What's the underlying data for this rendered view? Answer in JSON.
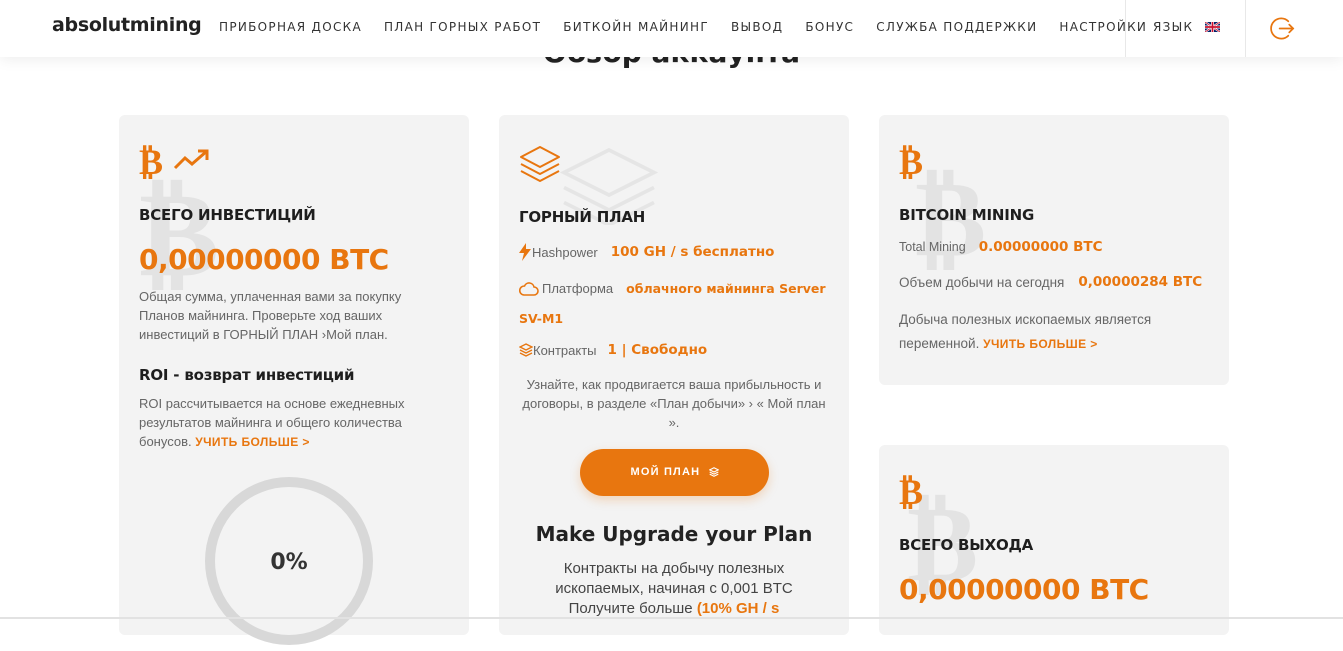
{
  "header": {
    "logo": "absolutmining",
    "nav": [
      "ПРИБОРНАЯ ДОСКА",
      "ПЛАН ГОРНЫХ РАБОТ",
      "БИТКОЙН МАЙНИНГ",
      "ВЫВОД",
      "БОНУС",
      "СЛУЖБА ПОДДЕРЖКИ",
      "НАСТРОЙКИ"
    ],
    "language_label": "ЯЗЫК"
  },
  "page_title": "Обзор аккаунта",
  "investments_card": {
    "title": "ВСЕГО ИНВЕСТИЦИЙ",
    "value": "0,00000000 BTC",
    "description": "Общая сумма, уплаченная вами за покупку Планов майнинга. Проверьте ход ваших инвестиций в ГОРНЫЙ ПЛАН ›Мой план.",
    "roi_title": "ROI - возврат инвестиций",
    "roi_description": "ROI рассчитывается на основе ежедневных результатов майнинга и общего количества бонусов.",
    "roi_link": "УЧИТЬ БОЛЬШЕ >",
    "roi_percent": "0%",
    "roi_progress": 0
  },
  "plan_card": {
    "title": "ГОРНЫЙ ПЛАН",
    "hashpower_label": "Hashpower",
    "hashpower_value": "100 GH / s бесплатно",
    "platform_label": "Платформа",
    "platform_value_1": "облачного майнинга Server",
    "platform_value_2": "SV-M1",
    "contracts_label": "Контракты",
    "contracts_value": "1 | Свободно",
    "info": "Узнайте, как продвигается ваша прибыльность и договоры, в разделе «План добычи» › « Мой план ».",
    "button_label": "МОЙ ПЛАН",
    "upgrade_title": "Make Upgrade your Plan",
    "upgrade_line1": "Контракты на добычу полезных",
    "upgrade_line2": "ископаемых, начиная с 0,001 BTC",
    "upgrade_line3": "Получите больше",
    "upgrade_highlight": "(10% GH / s"
  },
  "mining_card": {
    "title": "BITCOIN MINING",
    "total_label": "Total Mining",
    "total_value": "0.00000000 BTC",
    "today_label": "Объем добычи на сегодня",
    "today_value": "0,00000284 BTC",
    "desc": "Добыча полезных ископаемых является переменной.",
    "link": "УЧИТЬ БОЛЬШЕ >"
  },
  "withdraw_card": {
    "title": "ВСЕГО ВЫХОДА",
    "value": "0,00000000 BTC"
  },
  "colors": {
    "accent": "#e8760f",
    "card_bg": "#f3f3f3"
  }
}
